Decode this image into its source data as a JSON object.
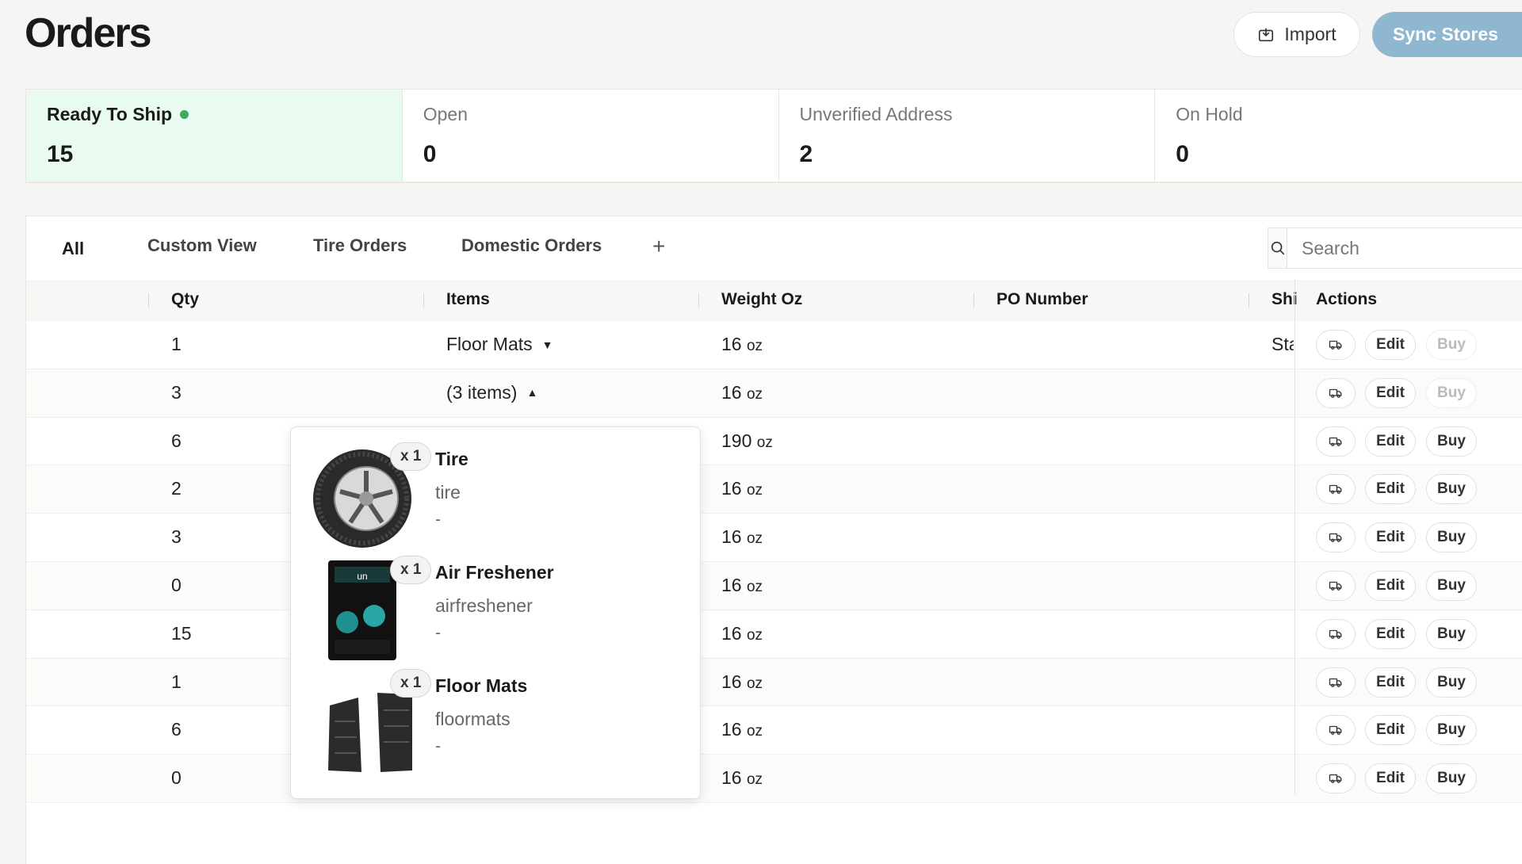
{
  "header": {
    "title": "Orders",
    "import_label": "Import",
    "sync_label": "Sync Stores"
  },
  "stats": [
    {
      "label": "Ready To Ship",
      "value": "15",
      "active": true
    },
    {
      "label": "Open",
      "value": "0"
    },
    {
      "label": "Unverified Address",
      "value": "2"
    },
    {
      "label": "On Hold",
      "value": "0"
    }
  ],
  "tabs": [
    "All",
    "Custom View",
    "Tire Orders",
    "Domestic Orders"
  ],
  "tab_add": "+",
  "search": {
    "placeholder": "Search"
  },
  "columns": {
    "qty": "Qty",
    "items": "Items",
    "weight": "Weight Oz",
    "po": "PO Number",
    "ship": "Shi",
    "actions": "Actions"
  },
  "weight_unit": "oz",
  "actions": {
    "edit": "Edit",
    "buy": "Buy"
  },
  "rows": [
    {
      "qty": "1",
      "items": "Floor Mats",
      "caret": "down",
      "weight": "16",
      "ship": "Sta",
      "buy_disabled": true
    },
    {
      "qty": "3",
      "items": "(3 items)",
      "caret": "up",
      "weight": "16",
      "ship": "",
      "buy_disabled": true
    },
    {
      "qty": "6",
      "items": "",
      "weight": "190",
      "ship": "",
      "buy_disabled": false
    },
    {
      "qty": "2",
      "items": "",
      "weight": "16",
      "ship": "",
      "buy_disabled": false
    },
    {
      "qty": "3",
      "items": "",
      "weight": "16",
      "ship": "",
      "buy_disabled": false
    },
    {
      "qty": "0",
      "items": "",
      "weight": "16",
      "ship": "",
      "buy_disabled": false
    },
    {
      "qty": "15",
      "items": "",
      "weight": "16",
      "ship": "",
      "buy_disabled": false
    },
    {
      "qty": "1",
      "items": "",
      "weight": "16",
      "ship": "",
      "buy_disabled": false
    },
    {
      "qty": "6",
      "items": "",
      "weight": "16",
      "ship": "",
      "buy_disabled": false
    },
    {
      "qty": "0",
      "items": "",
      "weight": "16",
      "ship": "",
      "buy_disabled": false
    }
  ],
  "popover_items": [
    {
      "name": "Tire",
      "sku": "tire",
      "note": "-",
      "qty_badge": "x 1",
      "image": "tire"
    },
    {
      "name": "Air Freshener",
      "sku": "airfreshener",
      "note": "-",
      "qty_badge": "x 1",
      "image": "air-freshener"
    },
    {
      "name": "Floor Mats",
      "sku": "floormats",
      "note": "-",
      "qty_badge": "x 1",
      "image": "floor-mats"
    }
  ],
  "colors": {
    "accent": "#8fb8d0",
    "active_card": "#e9faf1",
    "status_dot": "#3aaa5c"
  }
}
